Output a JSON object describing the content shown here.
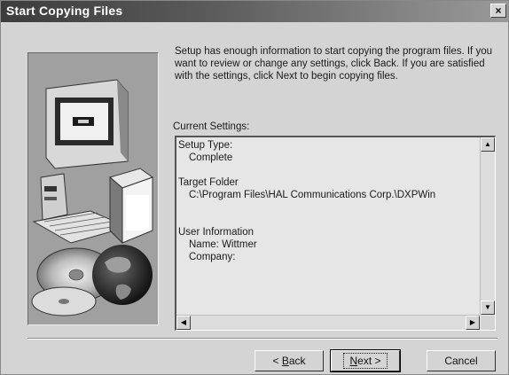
{
  "window": {
    "title": "Start Copying Files",
    "close_label": "×"
  },
  "info": {
    "text": "Setup has enough information to start copying the program files. If you want to review or change any settings, click Back.  If you are satisfied with the settings, click Next to begin copying files."
  },
  "settings": {
    "label": "Current Settings:",
    "lines": [
      {
        "text": "Setup Type:",
        "indent": false
      },
      {
        "text": "Complete",
        "indent": true
      },
      {
        "text": "",
        "indent": false
      },
      {
        "text": "Target Folder",
        "indent": false
      },
      {
        "text": "C:\\Program Files\\HAL Communications Corp.\\DXPWin",
        "indent": true
      },
      {
        "text": "",
        "indent": false
      },
      {
        "text": "",
        "indent": false
      },
      {
        "text": "User Information",
        "indent": false
      },
      {
        "text": "Name:  Wittmer",
        "indent": true
      },
      {
        "text": "Company:",
        "indent": true
      }
    ]
  },
  "buttons": {
    "back_prefix": "< ",
    "back_mnemonic": "B",
    "back_rest": "ack",
    "next_mnemonic": "N",
    "next_rest": "ext >",
    "cancel": "Cancel"
  },
  "icons": {
    "illustration": "computer-with-cd-and-box",
    "scroll_up": "▲",
    "scroll_down": "▼",
    "scroll_left": "◀",
    "scroll_right": "▶"
  }
}
